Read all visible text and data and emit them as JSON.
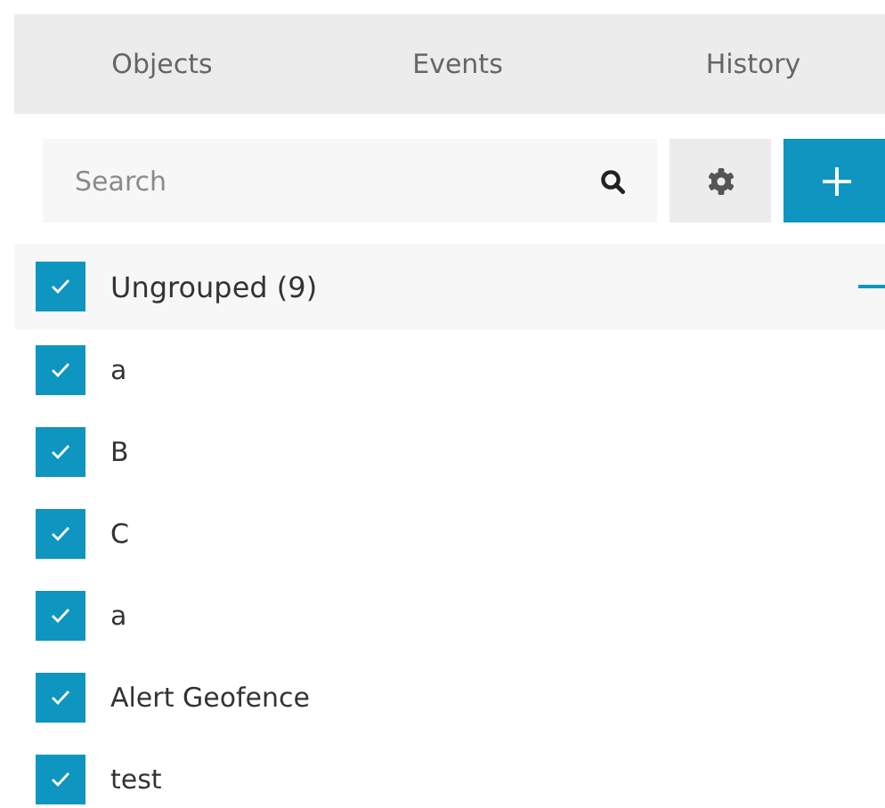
{
  "tabs": [
    {
      "label": "Objects"
    },
    {
      "label": "Events"
    },
    {
      "label": "History"
    }
  ],
  "search": {
    "placeholder": "Search"
  },
  "group": {
    "label": "Ungrouped (9)",
    "checked": true,
    "expanded": true
  },
  "items": [
    {
      "label": "a",
      "checked": true
    },
    {
      "label": "B",
      "checked": true
    },
    {
      "label": "C",
      "checked": true
    },
    {
      "label": "a",
      "checked": true
    },
    {
      "label": "Alert Geofence",
      "checked": true
    },
    {
      "label": "test",
      "checked": true
    }
  ]
}
